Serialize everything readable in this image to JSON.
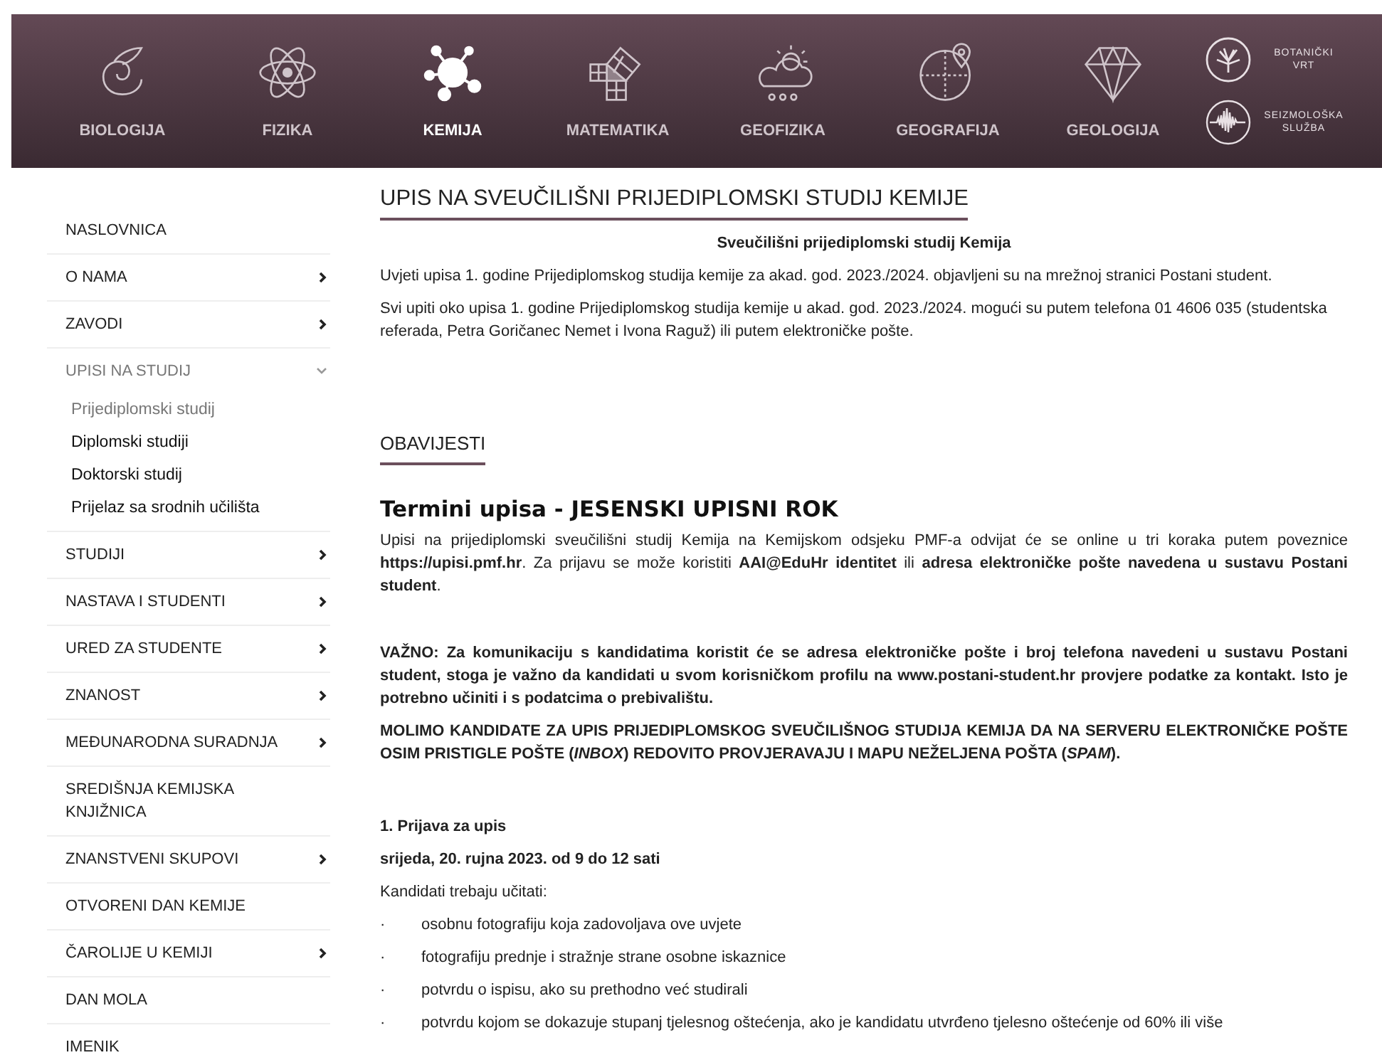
{
  "header": {
    "nav": [
      {
        "label": "BIOLOGIJA",
        "selected": false
      },
      {
        "label": "FIZIKA",
        "selected": false
      },
      {
        "label": "KEMIJA",
        "selected": true
      },
      {
        "label": "MATEMATIKA",
        "selected": false
      },
      {
        "label": "GEOFIZIKA",
        "selected": false
      },
      {
        "label": "GEOGRAFIJA",
        "selected": false
      },
      {
        "label": "GEOLOGIJA",
        "selected": false
      }
    ],
    "side_links": [
      {
        "lines": [
          "BOTANIČKI",
          "VRT"
        ]
      },
      {
        "lines": [
          "SEIZMOLOŠKA",
          "SLUŽBA"
        ]
      }
    ]
  },
  "sidebar": {
    "items": [
      {
        "label": "NASLOVNICA",
        "has_submenu": false,
        "selected": false
      },
      {
        "label": "O NAMA",
        "has_submenu": true,
        "expanded": false,
        "selected": false
      },
      {
        "label": "ZAVODI",
        "has_submenu": true,
        "expanded": false,
        "selected": false
      },
      {
        "label": "UPISI NA STUDIJ",
        "has_submenu": true,
        "expanded": true,
        "selected": true,
        "children": [
          {
            "label": "Prijediplomski studij",
            "selected": true
          },
          {
            "label": "Diplomski studiji",
            "selected": false
          },
          {
            "label": "Doktorski studij",
            "selected": false
          },
          {
            "label": "Prijelaz sa srodnih učilišta",
            "selected": false
          }
        ]
      },
      {
        "label": "STUDIJI",
        "has_submenu": true,
        "expanded": false,
        "selected": false
      },
      {
        "label": "NASTAVA I STUDENTI",
        "has_submenu": true,
        "expanded": false,
        "selected": false
      },
      {
        "label": "URED ZA STUDENTE",
        "has_submenu": true,
        "expanded": false,
        "selected": false
      },
      {
        "label": "ZNANOST",
        "has_submenu": true,
        "expanded": false,
        "selected": false
      },
      {
        "label": "MEĐUNARODNA SURADNJA",
        "has_submenu": true,
        "expanded": false,
        "selected": false
      },
      {
        "label": "SREDIŠNJA KEMIJSKA KNJIŽNICA",
        "has_submenu": false,
        "selected": false
      },
      {
        "label": "ZNANSTVENI SKUPOVI",
        "has_submenu": true,
        "expanded": false,
        "selected": false
      },
      {
        "label": "OTVORENI DAN KEMIJE",
        "has_submenu": false,
        "selected": false
      },
      {
        "label": "ČAROLIJE U KEMIJI",
        "has_submenu": true,
        "expanded": false,
        "selected": false
      },
      {
        "label": "DAN MOLA",
        "has_submenu": false,
        "selected": false
      },
      {
        "label": "IMENIK",
        "has_submenu": false,
        "selected": false
      }
    ]
  },
  "page": {
    "title": "UPIS NA SVEUČILIŠNI PRIJEDIPLOMSKI STUDIJ KEMIJE",
    "subtitle": "Sveučilišni prijediplomski studij Kemija",
    "paragraphs": [
      "Uvjeti upisa 1. godine Prijediplomskog studija kemije za akad. god. 2023./2024. objavljeni su na mrežnoj stranici Postani student.",
      "Svi  upiti oko upisa 1. godine Prijediplomskog studija kemije u akad. god. 2023./2024. mogući su putem telefona 01 4606 035 (studentska referada, Petra Goričanec Nemet i Ivona Raguž) ili putem elektroničke pošte."
    ]
  },
  "news": {
    "section_title": "OBAVIJESTI",
    "heading": "Termini upisa - JESENSKI UPISNI ROK",
    "blocks": [
      {
        "kind": "justified",
        "text": "Upisi na prijediplomski sveučilišni studij Kemija na Kemijskom odsjeku PMF-a odvijat će se online u tri koraka putem poveznice **https://upisi.pmf.hr**. Za prijavu se može koristiti **AAI@EduHr identitet** ili **adresa elektroničke pošte navedena u sustavu Postani student**."
      },
      {
        "kind": "bold",
        "text": "VAŽNO:  Za komunikaciju s kandidatima koristit će se adresa elektroničke pošte i broj telefona navedeni u sustavu Postani student, stoga je važno da kandidati u svom korisničkom profilu na www.postani-student.hr provjere podatke za kontakt. Isto je potrebno učiniti i s podatcima o prebivalištu."
      },
      {
        "kind": "bold",
        "text": "MOLIMO KANDIDATE ZA UPIS PRIJEDIPLOMSKOG SVEUČILIŠNOG STUDIJA KEMIJA DA NA SERVERU ELEKTRONIČKE POŠTE OSIM PRISTIGLE POŠTE (*INBOX*) REDOVITO PROVJERAVAJU I MAPU NEŽELJENA POŠTA (*SPAM*)."
      },
      {
        "kind": "bold",
        "text": "1. Prijava za upis"
      },
      {
        "kind": "bold",
        "text": "srijeda, 20. rujna 2023. od 9 do 12 sati"
      },
      {
        "kind": "plain",
        "text": "Kandidati trebaju učitati:"
      },
      {
        "kind": "bullet",
        "bullet": "·",
        "text": "osobnu fotografiju koja zadovoljava ove uvjete"
      },
      {
        "kind": "bullet",
        "bullet": "·",
        "text": "fotografiju prednje i stražnje strane osobne iskaznice"
      },
      {
        "kind": "bullet",
        "bullet": "·",
        "text": "potvrdu o ispisu, ako su prethodno već studirali"
      },
      {
        "kind": "bullet",
        "bullet": "·",
        "text": "potvrdu kojom se dokazuje stupanj tjelesnog oštećenja, ako je kandidatu utvrđeno tjelesno oštećenje od 60% ili više"
      }
    ]
  }
}
